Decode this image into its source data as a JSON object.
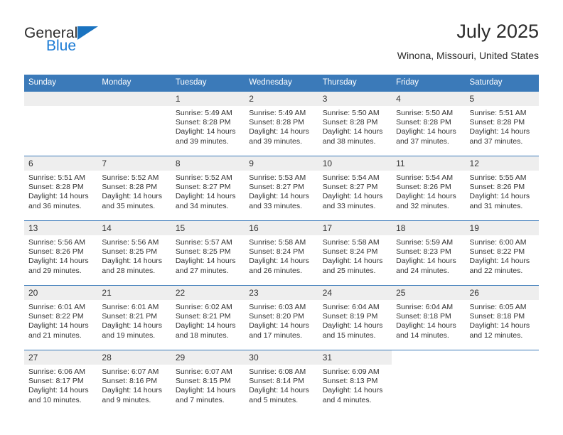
{
  "brand": {
    "line1": "General",
    "line2": "Blue",
    "triangle_icon": "triangle-icon",
    "accent_color": "#1a7ad4"
  },
  "header": {
    "title": "July 2025",
    "subtitle": "Winona, Missouri, United States"
  },
  "theme": {
    "header_blue": "#3b7ab9",
    "daynum_bg": "#eeeeee",
    "text": "#333333"
  },
  "weekday_headers": [
    "Sunday",
    "Monday",
    "Tuesday",
    "Wednesday",
    "Thursday",
    "Friday",
    "Saturday"
  ],
  "labels": {
    "sunrise": "Sunrise:",
    "sunset": "Sunset:",
    "daylight": "Daylight:"
  },
  "weeks": [
    [
      {
        "day": "",
        "sunrise": "",
        "sunset": "",
        "daylight_line1": "",
        "daylight_line2": "",
        "empty": true
      },
      {
        "day": "",
        "sunrise": "",
        "sunset": "",
        "daylight_line1": "",
        "daylight_line2": "",
        "empty": true
      },
      {
        "day": "1",
        "sunrise": "Sunrise: 5:49 AM",
        "sunset": "Sunset: 8:28 PM",
        "daylight_line1": "Daylight: 14 hours",
        "daylight_line2": "and 39 minutes."
      },
      {
        "day": "2",
        "sunrise": "Sunrise: 5:49 AM",
        "sunset": "Sunset: 8:28 PM",
        "daylight_line1": "Daylight: 14 hours",
        "daylight_line2": "and 39 minutes."
      },
      {
        "day": "3",
        "sunrise": "Sunrise: 5:50 AM",
        "sunset": "Sunset: 8:28 PM",
        "daylight_line1": "Daylight: 14 hours",
        "daylight_line2": "and 38 minutes."
      },
      {
        "day": "4",
        "sunrise": "Sunrise: 5:50 AM",
        "sunset": "Sunset: 8:28 PM",
        "daylight_line1": "Daylight: 14 hours",
        "daylight_line2": "and 37 minutes."
      },
      {
        "day": "5",
        "sunrise": "Sunrise: 5:51 AM",
        "sunset": "Sunset: 8:28 PM",
        "daylight_line1": "Daylight: 14 hours",
        "daylight_line2": "and 37 minutes."
      }
    ],
    [
      {
        "day": "6",
        "sunrise": "Sunrise: 5:51 AM",
        "sunset": "Sunset: 8:28 PM",
        "daylight_line1": "Daylight: 14 hours",
        "daylight_line2": "and 36 minutes."
      },
      {
        "day": "7",
        "sunrise": "Sunrise: 5:52 AM",
        "sunset": "Sunset: 8:28 PM",
        "daylight_line1": "Daylight: 14 hours",
        "daylight_line2": "and 35 minutes."
      },
      {
        "day": "8",
        "sunrise": "Sunrise: 5:52 AM",
        "sunset": "Sunset: 8:27 PM",
        "daylight_line1": "Daylight: 14 hours",
        "daylight_line2": "and 34 minutes."
      },
      {
        "day": "9",
        "sunrise": "Sunrise: 5:53 AM",
        "sunset": "Sunset: 8:27 PM",
        "daylight_line1": "Daylight: 14 hours",
        "daylight_line2": "and 33 minutes."
      },
      {
        "day": "10",
        "sunrise": "Sunrise: 5:54 AM",
        "sunset": "Sunset: 8:27 PM",
        "daylight_line1": "Daylight: 14 hours",
        "daylight_line2": "and 33 minutes."
      },
      {
        "day": "11",
        "sunrise": "Sunrise: 5:54 AM",
        "sunset": "Sunset: 8:26 PM",
        "daylight_line1": "Daylight: 14 hours",
        "daylight_line2": "and 32 minutes."
      },
      {
        "day": "12",
        "sunrise": "Sunrise: 5:55 AM",
        "sunset": "Sunset: 8:26 PM",
        "daylight_line1": "Daylight: 14 hours",
        "daylight_line2": "and 31 minutes."
      }
    ],
    [
      {
        "day": "13",
        "sunrise": "Sunrise: 5:56 AM",
        "sunset": "Sunset: 8:26 PM",
        "daylight_line1": "Daylight: 14 hours",
        "daylight_line2": "and 29 minutes."
      },
      {
        "day": "14",
        "sunrise": "Sunrise: 5:56 AM",
        "sunset": "Sunset: 8:25 PM",
        "daylight_line1": "Daylight: 14 hours",
        "daylight_line2": "and 28 minutes."
      },
      {
        "day": "15",
        "sunrise": "Sunrise: 5:57 AM",
        "sunset": "Sunset: 8:25 PM",
        "daylight_line1": "Daylight: 14 hours",
        "daylight_line2": "and 27 minutes."
      },
      {
        "day": "16",
        "sunrise": "Sunrise: 5:58 AM",
        "sunset": "Sunset: 8:24 PM",
        "daylight_line1": "Daylight: 14 hours",
        "daylight_line2": "and 26 minutes."
      },
      {
        "day": "17",
        "sunrise": "Sunrise: 5:58 AM",
        "sunset": "Sunset: 8:24 PM",
        "daylight_line1": "Daylight: 14 hours",
        "daylight_line2": "and 25 minutes."
      },
      {
        "day": "18",
        "sunrise": "Sunrise: 5:59 AM",
        "sunset": "Sunset: 8:23 PM",
        "daylight_line1": "Daylight: 14 hours",
        "daylight_line2": "and 24 minutes."
      },
      {
        "day": "19",
        "sunrise": "Sunrise: 6:00 AM",
        "sunset": "Sunset: 8:22 PM",
        "daylight_line1": "Daylight: 14 hours",
        "daylight_line2": "and 22 minutes."
      }
    ],
    [
      {
        "day": "20",
        "sunrise": "Sunrise: 6:01 AM",
        "sunset": "Sunset: 8:22 PM",
        "daylight_line1": "Daylight: 14 hours",
        "daylight_line2": "and 21 minutes."
      },
      {
        "day": "21",
        "sunrise": "Sunrise: 6:01 AM",
        "sunset": "Sunset: 8:21 PM",
        "daylight_line1": "Daylight: 14 hours",
        "daylight_line2": "and 19 minutes."
      },
      {
        "day": "22",
        "sunrise": "Sunrise: 6:02 AM",
        "sunset": "Sunset: 8:21 PM",
        "daylight_line1": "Daylight: 14 hours",
        "daylight_line2": "and 18 minutes."
      },
      {
        "day": "23",
        "sunrise": "Sunrise: 6:03 AM",
        "sunset": "Sunset: 8:20 PM",
        "daylight_line1": "Daylight: 14 hours",
        "daylight_line2": "and 17 minutes."
      },
      {
        "day": "24",
        "sunrise": "Sunrise: 6:04 AM",
        "sunset": "Sunset: 8:19 PM",
        "daylight_line1": "Daylight: 14 hours",
        "daylight_line2": "and 15 minutes."
      },
      {
        "day": "25",
        "sunrise": "Sunrise: 6:04 AM",
        "sunset": "Sunset: 8:18 PM",
        "daylight_line1": "Daylight: 14 hours",
        "daylight_line2": "and 14 minutes."
      },
      {
        "day": "26",
        "sunrise": "Sunrise: 6:05 AM",
        "sunset": "Sunset: 8:18 PM",
        "daylight_line1": "Daylight: 14 hours",
        "daylight_line2": "and 12 minutes."
      }
    ],
    [
      {
        "day": "27",
        "sunrise": "Sunrise: 6:06 AM",
        "sunset": "Sunset: 8:17 PM",
        "daylight_line1": "Daylight: 14 hours",
        "daylight_line2": "and 10 minutes."
      },
      {
        "day": "28",
        "sunrise": "Sunrise: 6:07 AM",
        "sunset": "Sunset: 8:16 PM",
        "daylight_line1": "Daylight: 14 hours",
        "daylight_line2": "and 9 minutes."
      },
      {
        "day": "29",
        "sunrise": "Sunrise: 6:07 AM",
        "sunset": "Sunset: 8:15 PM",
        "daylight_line1": "Daylight: 14 hours",
        "daylight_line2": "and 7 minutes."
      },
      {
        "day": "30",
        "sunrise": "Sunrise: 6:08 AM",
        "sunset": "Sunset: 8:14 PM",
        "daylight_line1": "Daylight: 14 hours",
        "daylight_line2": "and 5 minutes."
      },
      {
        "day": "31",
        "sunrise": "Sunrise: 6:09 AM",
        "sunset": "Sunset: 8:13 PM",
        "daylight_line1": "Daylight: 14 hours",
        "daylight_line2": "and 4 minutes."
      },
      {
        "day": "",
        "sunrise": "",
        "sunset": "",
        "daylight_line1": "",
        "daylight_line2": "",
        "blank": true
      },
      {
        "day": "",
        "sunrise": "",
        "sunset": "",
        "daylight_line1": "",
        "daylight_line2": "",
        "blank": true
      }
    ]
  ]
}
